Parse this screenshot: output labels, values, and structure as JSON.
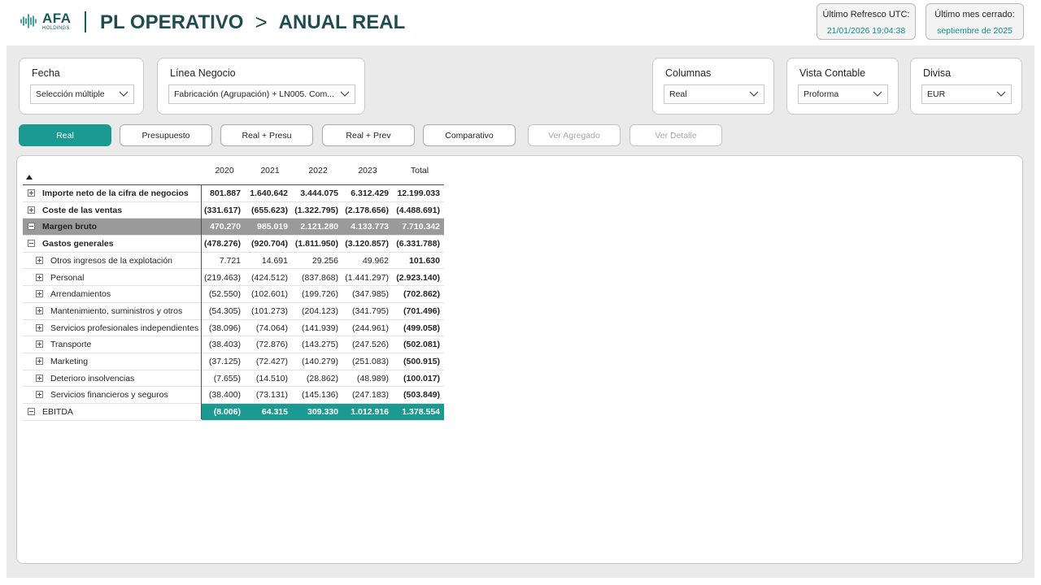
{
  "header": {
    "logo_name": "AFA",
    "logo_sub": "HOLDINGS",
    "title_part1": "PL OPERATIVO",
    "title_separator": ">",
    "title_part2": "ANUAL REAL"
  },
  "info_cards": [
    {
      "label": "Último Refresco UTC:",
      "value": "21/01/2026 19:04:38"
    },
    {
      "label": "Último mes cerrado:",
      "value": "septiembre de 2025"
    }
  ],
  "slicers": {
    "fecha": {
      "title": "Fecha",
      "value": "Selección múltiple"
    },
    "linea": {
      "title": "Línea Negocio",
      "value": "Fabricación (Agrupación) + LN005. Com..."
    },
    "columnas": {
      "title": "Columnas",
      "value": "Real"
    },
    "vista": {
      "title": "Vista Contable",
      "value": "Proforma"
    },
    "divisa": {
      "title": "Divisa",
      "value": "EUR"
    }
  },
  "tabs": [
    {
      "label": "Real",
      "state": "active"
    },
    {
      "label": "Presupuesto",
      "state": "normal"
    },
    {
      "label": "Real + Presu",
      "state": "normal"
    },
    {
      "label": "Real + Prev",
      "state": "normal"
    },
    {
      "label": "Comparativo",
      "state": "normal"
    },
    {
      "label": "Ver Agregado",
      "state": "disabled"
    },
    {
      "label": "Ver Detalle",
      "state": "disabled"
    }
  ],
  "matrix": {
    "columns": [
      "2020",
      "2021",
      "2022",
      "2023",
      "Total"
    ],
    "rows": [
      {
        "label": "Importe neto de la cifra de negocios",
        "level": 0,
        "expander": "plus",
        "style": "bold",
        "values": [
          "801.887",
          "1.640.642",
          "3.444.075",
          "6.312.429",
          "12.199.033"
        ]
      },
      {
        "label": "Coste de las ventas",
        "level": 0,
        "expander": "plus",
        "style": "bold",
        "values": [
          "(331.617)",
          "(655.623)",
          "(1.322.795)",
          "(2.178.656)",
          "(4.488.691)"
        ]
      },
      {
        "label": "Margen bruto",
        "level": 0,
        "expander": "minus",
        "style": "margin",
        "values": [
          "470.270",
          "985.019",
          "2.121.280",
          "4.133.773",
          "7.710.342"
        ]
      },
      {
        "label": "Gastos generales",
        "level": 0,
        "expander": "minus",
        "style": "bold",
        "values": [
          "(478.276)",
          "(920.704)",
          "(1.811.950)",
          "(3.120.857)",
          "(6.331.788)"
        ]
      },
      {
        "label": "Otros ingresos de la explotación",
        "level": 1,
        "expander": "plus",
        "style": "normal",
        "values": [
          "7.721",
          "14.691",
          "29.256",
          "49.962",
          "101.630"
        ]
      },
      {
        "label": "Personal",
        "level": 1,
        "expander": "plus",
        "style": "normal",
        "values": [
          "(219.463)",
          "(424.512)",
          "(837.868)",
          "(1.441.297)",
          "(2.923.140)"
        ]
      },
      {
        "label": "Arrendamientos",
        "level": 1,
        "expander": "plus",
        "style": "normal",
        "values": [
          "(52.550)",
          "(102.601)",
          "(199.726)",
          "(347.985)",
          "(702.862)"
        ]
      },
      {
        "label": "Mantenimiento, suministros y otros",
        "level": 1,
        "expander": "plus",
        "style": "normal",
        "values": [
          "(54.305)",
          "(101.273)",
          "(204.123)",
          "(341.795)",
          "(701.496)"
        ]
      },
      {
        "label": "Servicios profesionales independientes",
        "level": 1,
        "expander": "plus",
        "style": "normal",
        "values": [
          "(38.096)",
          "(74.064)",
          "(141.939)",
          "(244.961)",
          "(499.058)"
        ]
      },
      {
        "label": "Transporte",
        "level": 1,
        "expander": "plus",
        "style": "normal",
        "values": [
          "(38.403)",
          "(72.876)",
          "(143.275)",
          "(247.526)",
          "(502.081)"
        ]
      },
      {
        "label": "Marketing",
        "level": 1,
        "expander": "plus",
        "style": "normal",
        "values": [
          "(37.125)",
          "(72.427)",
          "(140.279)",
          "(251.083)",
          "(500.915)"
        ]
      },
      {
        "label": "Deterioro insolvencias",
        "level": 1,
        "expander": "plus",
        "style": "normal",
        "values": [
          "(7.655)",
          "(14.510)",
          "(28.862)",
          "(48.989)",
          "(100.017)"
        ]
      },
      {
        "label": "Servicios financieros y seguros",
        "level": 1,
        "expander": "plus",
        "style": "normal",
        "values": [
          "(38.400)",
          "(73.131)",
          "(145.136)",
          "(247.183)",
          "(503.849)"
        ]
      },
      {
        "label": "EBITDA",
        "level": 0,
        "expander": "minus",
        "style": "ebitda",
        "values": [
          "(8.006)",
          "64.315",
          "309.330",
          "1.012.916",
          "1.378.554"
        ]
      }
    ]
  },
  "colors": {
    "brand_dark": "#1d4d4f",
    "accent_teal": "#1b9a92",
    "info_value": "#118d8d",
    "margin_grey": "#9a9a9a"
  },
  "icons": {
    "logo": "wave-logo-icon",
    "dropdown": "chevron-down-icon",
    "sort": "sort-ascending-icon",
    "expand": "plus-box-icon",
    "collapse": "minus-box-icon"
  }
}
